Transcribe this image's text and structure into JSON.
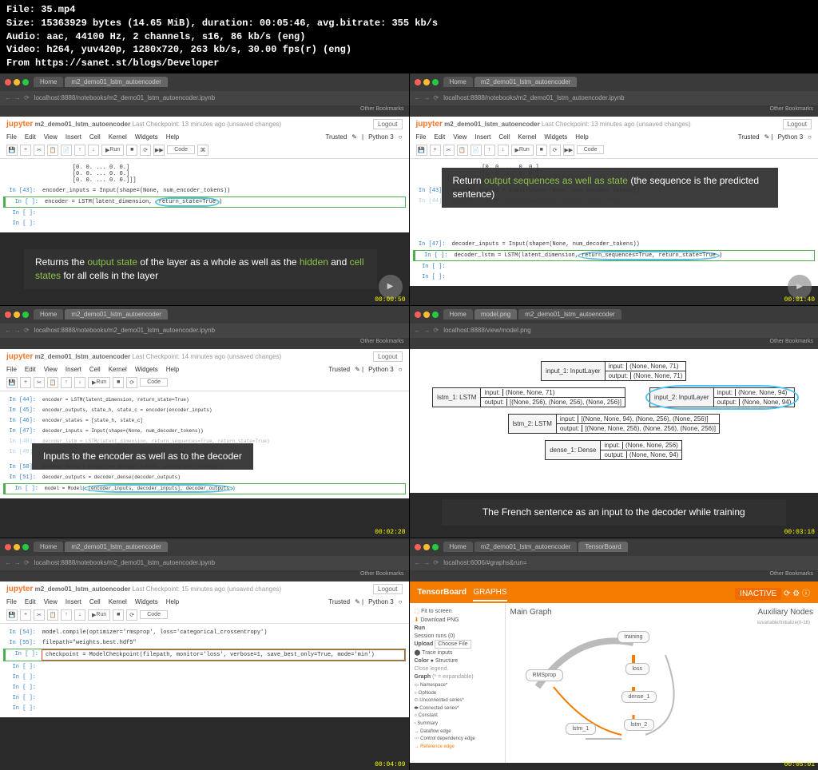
{
  "file_info": {
    "filename": "File: 35.mp4",
    "size": "Size: 15363929 bytes (14.65 MiB), duration: 00:05:46, avg.bitrate: 355 kb/s",
    "audio": "Audio: aac, 44100 Hz, 2 channels, s16, 86 kb/s (eng)",
    "video": "Video: h264, yuv420p, 1280x720, 263 kb/s, 30.00 fps(r) (eng)",
    "source": "From https://sanet.st/blogs/Developer"
  },
  "browser": {
    "home_tab": "Home",
    "notebook_tab": "m2_demo01_lstm_autoencoder",
    "model_tab": "model.png",
    "tensorboard_tab": "TensorBoard",
    "url_notebook": "localhost:8888/notebooks/m2_demo01_lstm_autoencoder.ipynb",
    "url_model": "localhost:8888/view/model.png",
    "url_tb": "localhost:6006/#graphs&run=",
    "bookmarks": "Other Bookmarks"
  },
  "jupyter": {
    "logo": "jupyter",
    "title": "m2_demo01_lstm_autoencoder",
    "checkpoint_13": "Last Checkpoint: 13 minutes ago (unsaved changes)",
    "checkpoint_14": "Last Checkpoint: 14 minutes ago (unsaved changes)",
    "checkpoint_15": "Last Checkpoint: 15 minutes ago (unsaved changes)",
    "logout": "Logout",
    "trusted": "Trusted",
    "kernel": "Python 3",
    "menu": {
      "file": "File",
      "edit": "Edit",
      "view": "View",
      "insert": "Insert",
      "cell": "Cell",
      "kernel": "Kernel",
      "widgets": "Widgets",
      "help": "Help"
    },
    "toolbar": {
      "run": "Run",
      "code": "Code"
    }
  },
  "panel1": {
    "output_zeros": "         [0. 0. ... 0. 0.]\n         [0. 0. ... 0. 0.]\n         [0. 0. ... 0. 0.]]]",
    "cell43_prompt": "In [43]:",
    "cell43_code": "encoder_inputs = Input(shape=(None, num_encoder_tokens))",
    "cell_hl_prompt": "In [ ]:",
    "cell_hl_code": "encoder = LSTM(latent_dimension, ",
    "cell_hl_annot": "return_state=True",
    "cell_hl_close": ")",
    "empty_prompt": "In [ ]:",
    "caption_p1": "Returns the ",
    "caption_g1": "output state",
    "caption_p2": " of the layer as a whole as well as the ",
    "caption_g2": "hidden",
    "caption_p3": " and ",
    "caption_g3": "cell states",
    "caption_p4": " for all cells in the layer",
    "timestamp": "00:00:50"
  },
  "panel2": {
    "cell43_prompt": "In [43]:",
    "cell43_code": "encoder_inputs = Input(shape=(None, num_encoder_tokens))",
    "cell44_prompt": "In [44]:",
    "cell44_code": "encoder = LSTM(latent_dimension, return_state=True)",
    "cell47_prompt": "In [47]:",
    "cell47_code": "decoder_inputs = Input(shape=(None, num_decoder_tokens))",
    "cell_hl_prompt": "In [ ]:",
    "cell_hl_code": "decoder_lstm = LSTM(latent_dimension,",
    "cell_hl_annot": "return_sequences=True, return_state=True",
    "cell_hl_close": ")",
    "caption_p1": "Return ",
    "caption_g1": "output sequences as well as state",
    "caption_p2": " (the sequence is the predicted sentence)",
    "timestamp": "00:01:40"
  },
  "panel3": {
    "cell44_prompt": "In [44]:",
    "cell44": "encoder = LSTM(latent_dimension, return_state=True)",
    "cell45_prompt": "In [45]:",
    "cell45": "encoder_outputs, state_h, state_c = encoder(encoder_inputs)",
    "cell46_prompt": "In [46]:",
    "cell46": "encoder_states = [state_h, state_c]",
    "cell47_prompt": "In [47]:",
    "cell47": "decoder_inputs = Input(shape=(None, num_decoder_tokens))",
    "cell48_prompt": "In [48]:",
    "cell48": "decoder_lstm = LSTM(latent_dimension, return_sequences=True, return_state=True)",
    "cell49_prompt": "In [49]:",
    "cell49": "decoder_outputs, _, _ = decoder_lstm(decoder_inputs,\n                                     initial_state=encoder_states)",
    "cell50_prompt": "In [50]:",
    "cell50": "decoder_dense = Dense(num_decoder_tokens, activation='softmax')",
    "cell51_prompt": "In [51]:",
    "cell51": "decoder_outputs = decoder_dense(decoder_outputs)",
    "cell_hl_prompt": "In [ ]:",
    "cell_hl_pre": "model = Model(",
    "cell_hl_annot": "[encoder_inputs, decoder_inputs], decoder_outputs",
    "cell_hl_close": ")",
    "caption": "Inputs to the encoder as well as to the decoder",
    "timestamp": "00:02:28"
  },
  "panel4": {
    "input1_label": "input_1: InputLayer",
    "input1_in": "(None, None, 71)",
    "input1_out": "(None, None, 71)",
    "lstm1_label": "lstm_1: LSTM",
    "lstm1_in": "(None, None, 71)",
    "lstm1_out": "[(None, 256), (None, 256), (None, 256)]",
    "input2_label": "input_2: InputLayer",
    "input2_in": "(None, None, 94)",
    "input2_out": "(None, None, 94)",
    "lstm2_label": "lstm_2: LSTM",
    "lstm2_in": "[(None, None, 94), (None, 256), (None, 256)]",
    "lstm2_out": "[(None, None, 256), (None, 256), (None, 256)]",
    "dense_label": "dense_1: Dense",
    "dense_in": "(None, None, 256)",
    "dense_out": "(None, None, 94)",
    "io_input": "input:",
    "io_output": "output:",
    "caption": "The French sentence as an input to the decoder while training",
    "timestamp": "00:03:18"
  },
  "panel5": {
    "cell54_prompt": "In [54]:",
    "cell54": "model.compile(optimizer='rmsprop', loss='categorical_crossentropy')",
    "cell55_prompt": "In [55]:",
    "cell55": "filepath=\"weights.best.hdf5\"",
    "cell_hl_prompt": "In [ ]:",
    "cell_hl": "checkpoint = ModelCheckpoint(filepath, monitor='loss', verbose=1, save_best_only=True, mode='min')",
    "timestamp": "00:04:09"
  },
  "panel6": {
    "title": "TensorBoard",
    "tab_graphs": "GRAPHS",
    "inactive": "INACTIVE",
    "fit": "Fit to screen",
    "download": "Download PNG",
    "run": "Run",
    "session": "Session runs (0)",
    "upload": "Upload",
    "choose": "Choose File",
    "trace": "Trace inputs",
    "color": "Color",
    "structure": "Structure",
    "legend": "Close legend.",
    "graph": "Graph",
    "legend_items": {
      "ns": "Namespace*",
      "op": "OpNode",
      "us": "Unconnected series*",
      "cs": "Connected series*",
      "const": "Constant",
      "summ": "Summary",
      "df": "Dataflow edge",
      "cd": "Control dependency edge",
      "ref": "Reference edge"
    },
    "main_graph": "Main Graph",
    "aux_nodes": "Auxiliary Nodes",
    "node_training": "training",
    "node_loss": "loss",
    "node_dense": "dense_1",
    "node_lstm2": "lstm_2",
    "node_lstm1": "lstm_1",
    "node_rms": "RMSprop",
    "node_init": "is/variable/Initialize(0-16)",
    "timestamp": "00:05:01"
  }
}
